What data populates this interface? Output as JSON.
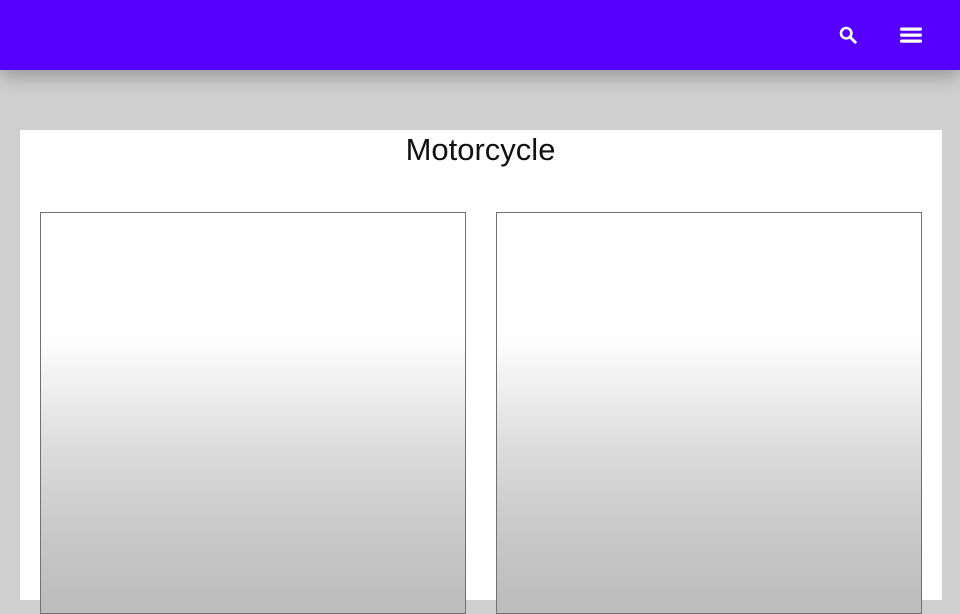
{
  "header": {
    "background_color": "#5500ff",
    "search_icon": "search-icon",
    "menu_icon": "hamburger-menu-icon"
  },
  "page": {
    "title": "Motorcycle",
    "background_color": "#cfcfcf"
  },
  "products": [
    {
      "image": "product-image-placeholder"
    },
    {
      "image": "product-image-placeholder"
    }
  ]
}
